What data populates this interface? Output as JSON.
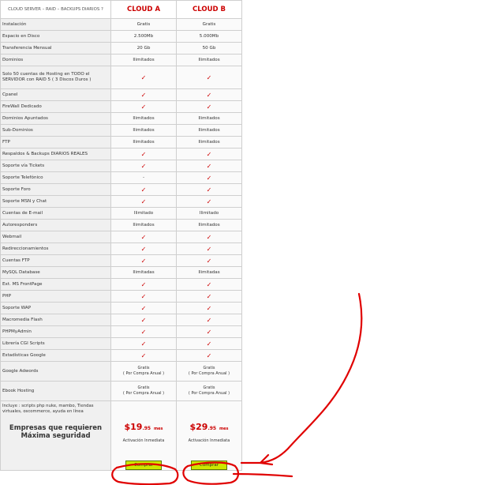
{
  "header": {
    "product": "CLOUD SERVER – RAID – BACKUPS DIARIOS ?",
    "plan_a": "CLOUD A",
    "plan_b": "CLOUD B"
  },
  "rows": [
    {
      "feature": "Instalación",
      "a": "Gratis",
      "b": "Gratis"
    },
    {
      "feature": "Espacio en Disco",
      "a": "2.500Mb",
      "b": "5.000Mb"
    },
    {
      "feature": "Transferencia Mensual",
      "a": "20 Gb",
      "b": "50 Gb"
    },
    {
      "feature": "Dominios",
      "a": "Ilimitados",
      "b": "Ilimitados"
    },
    {
      "feature": "Solo 50 cuentas de Hosting en TODO el SERVIDOR con RAID 5 ( 3 Discos Duros )",
      "a": "✓",
      "b": "✓"
    },
    {
      "feature": "Cpanel",
      "a": "✓",
      "b": "✓"
    },
    {
      "feature": "FireWall Dedicado",
      "a": "✓",
      "b": "✓"
    },
    {
      "feature": "Dominios Apuntados",
      "a": "Ilimitados",
      "b": "Ilimitados"
    },
    {
      "feature": "Sub-Dominios",
      "a": "Ilimitados",
      "b": "Ilimitados"
    },
    {
      "feature": "FTP",
      "a": "Ilimitados",
      "b": "Ilimitados"
    },
    {
      "feature": "Respaldos & Backups DIARIOS REALES",
      "a": "✓",
      "b": "✓"
    },
    {
      "feature": "Soporte vía Tickets",
      "a": "✓",
      "b": "✓"
    },
    {
      "feature": "Soporte Telefónico",
      "a": "-",
      "b": "✓"
    },
    {
      "feature": "Soporte Foro",
      "a": "✓",
      "b": "✓"
    },
    {
      "feature": "Soporte MSN y Chat",
      "a": "✓",
      "b": "✓"
    },
    {
      "feature": "Cuentas de E-mail",
      "a": "Ilimitado",
      "b": "Ilimitado"
    },
    {
      "feature": "Autoresponders",
      "a": "Ilimitados",
      "b": "Ilimitados"
    },
    {
      "feature": "Webmail",
      "a": "✓",
      "b": "✓"
    },
    {
      "feature": "Redireccionamientos",
      "a": "✓",
      "b": "✓"
    },
    {
      "feature": "Cuentas FTP",
      "a": "✓",
      "b": "✓"
    },
    {
      "feature": "MySQL Database",
      "a": "Ilimitadas",
      "b": "Ilimitadas"
    },
    {
      "feature": "Ext. MS FrontPage",
      "a": "✓",
      "b": "✓"
    },
    {
      "feature": "PHP",
      "a": "✓",
      "b": "✓"
    },
    {
      "feature": "Soporte WAP",
      "a": "✓",
      "b": "✓"
    },
    {
      "feature": "Macromedia Flash",
      "a": "✓",
      "b": "✓"
    },
    {
      "feature": "PHPMyAdmin",
      "a": "✓",
      "b": "✓"
    },
    {
      "feature": "Librería CGI Scripts",
      "a": "✓",
      "b": "✓"
    },
    {
      "feature": "Estadísticas Google",
      "a": "✓",
      "b": "✓"
    }
  ],
  "google_adwords": {
    "feature": "Google Adwords",
    "line1": "Gratis",
    "line2": "( Por Compra Anual )"
  },
  "ebook": {
    "feature": "Ebook Hosting",
    "line1": "Gratis",
    "line2": "( Por Compra Anual )"
  },
  "footer": {
    "includes": "Incluye : scripts php nuke, mambo, Tiendas virtuales, oscommerce, ayuda en línea",
    "slogan": "Empresas que requieren Máxima seguridad",
    "plan_a_price": "$19",
    "plan_a_cents": ".95",
    "plan_b_price": "$29",
    "plan_b_cents": ".95",
    "per_month": "mes",
    "activation": "Activación Inmediata",
    "buy_label": "Comprar"
  },
  "colors": {
    "annotation": "#e00000",
    "price": "#cc0000",
    "button": "#cce800"
  }
}
